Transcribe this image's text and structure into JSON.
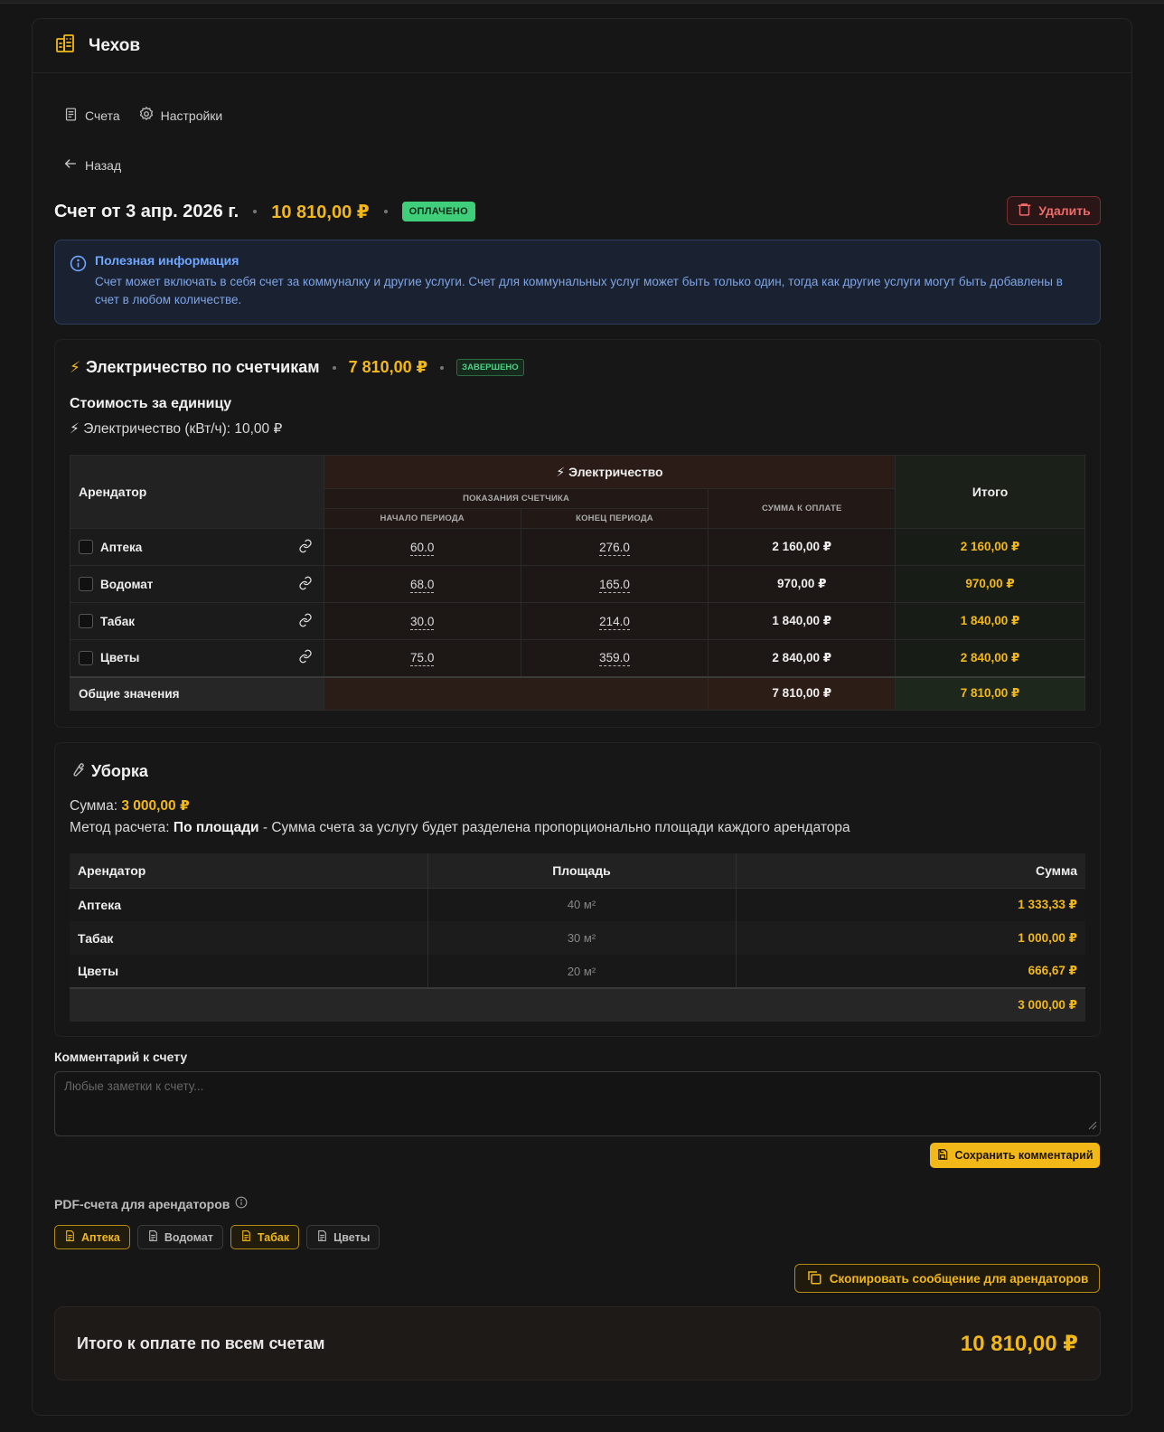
{
  "app": {
    "title": "Чехов"
  },
  "nav": {
    "bills": "Счета",
    "settings": "Настройки"
  },
  "back": "Назад",
  "bill": {
    "title": "Счет от 3 апр. 2026 г.",
    "amount": "10 810,00 ₽",
    "status": "ОПЛАЧЕНО",
    "delete_label": "Удалить"
  },
  "info": {
    "title": "Полезная информация",
    "text": "Счет может включать в себя счет за коммуналку и другие услуги. Счет для коммунальных услуг может быть только один, тогда как другие услуги могут быть добавлены в счет в любом количестве."
  },
  "electricity": {
    "icon": "⚡",
    "title": "Электричество по счетчикам",
    "amount": "7 810,00 ₽",
    "status": "ЗАВЕРШЕНО",
    "unit_cost_title": "Стоимость за единицу",
    "unit_cost_line": "⚡ Электричество (кВт/ч): 10,00 ₽",
    "headers": {
      "tenant": "Арендатор",
      "group": "⚡ Электричество",
      "readings": "ПОКАЗАНИЯ СЧЕТЧИКА",
      "start": "НАЧАЛО ПЕРИОДА",
      "end": "КОНЕЦ ПЕРИОДА",
      "due": "СУММА К ОПЛАТЕ",
      "total": "Итого"
    },
    "rows": [
      {
        "tenant": "Аптека",
        "start": "60.0",
        "end": "276.0",
        "due": "2 160,00 ₽",
        "total": "2 160,00 ₽"
      },
      {
        "tenant": "Водомат",
        "start": "68.0",
        "end": "165.0",
        "due": "970,00 ₽",
        "total": "970,00 ₽"
      },
      {
        "tenant": "Табак",
        "start": "30.0",
        "end": "214.0",
        "due": "1 840,00 ₽",
        "total": "1 840,00 ₽"
      },
      {
        "tenant": "Цветы",
        "start": "75.0",
        "end": "359.0",
        "due": "2 840,00 ₽",
        "total": "2 840,00 ₽"
      }
    ],
    "footer": {
      "label": "Общие значения",
      "due": "7 810,00 ₽",
      "total": "7 810,00 ₽"
    }
  },
  "cleaning": {
    "title": "Уборка",
    "sum_label": "Сумма:",
    "sum_value": "3 000,00 ₽",
    "method_label": "Метод расчета:",
    "method_value": "По площади",
    "method_desc": "- Сумма счета за услугу будет разделена пропорционально площади каждого арендатора",
    "headers": {
      "tenant": "Арендатор",
      "area": "Площадь",
      "sum": "Сумма"
    },
    "rows": [
      {
        "tenant": "Аптека",
        "area": "40 м²",
        "sum": "1 333,33 ₽"
      },
      {
        "tenant": "Табак",
        "area": "30 м²",
        "sum": "1 000,00 ₽"
      },
      {
        "tenant": "Цветы",
        "area": "20 м²",
        "sum": "666,67 ₽"
      }
    ],
    "footer_total": "3 000,00 ₽"
  },
  "comment": {
    "label": "Комментарий к счету",
    "placeholder": "Любые заметки к счету...",
    "save_label": "Сохранить комментарий"
  },
  "pdf": {
    "label": "PDF-счета для арендаторов",
    "chips": [
      "Аптека",
      "Водомат",
      "Табак",
      "Цветы"
    ]
  },
  "copy_label": "Скопировать сообщение для арендаторов",
  "grand_total": {
    "label": "Итого к оплате по всем счетам",
    "amount": "10 810,00 ₽"
  },
  "colors": {
    "accent": "#f2b818",
    "success": "#3fcf7a",
    "danger": "#ef6b6b",
    "info": "#6fa6ff"
  }
}
